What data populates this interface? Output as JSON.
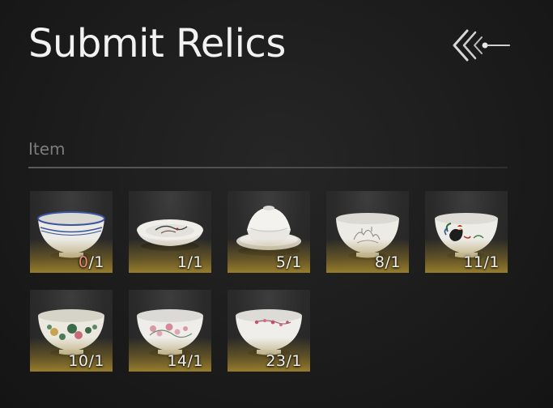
{
  "header": {
    "title": "Submit Relics",
    "back_icon": "double-chevron-left-icon"
  },
  "section": {
    "label": "Item"
  },
  "colors": {
    "insufficient": "#e58a7a",
    "sufficient": "#f0f0f0",
    "slot_glow": "#aa8c2d"
  },
  "items": [
    {
      "icon": "blue-rim-bowl-icon",
      "have": "0",
      "need": "1"
    },
    {
      "icon": "ink-dish-icon",
      "have": "1",
      "need": "1"
    },
    {
      "icon": "lidded-cup-icon",
      "have": "5",
      "need": "1"
    },
    {
      "icon": "landscape-bowl-icon",
      "have": "8",
      "need": "1"
    },
    {
      "icon": "rooster-bowl-icon",
      "have": "11",
      "need": "1"
    },
    {
      "icon": "peony-bowl-icon",
      "have": "10",
      "need": "1"
    },
    {
      "icon": "pink-blossom-bowl-icon",
      "have": "14",
      "need": "1"
    },
    {
      "icon": "plum-blossom-bowl-icon",
      "have": "23",
      "need": "1"
    }
  ]
}
